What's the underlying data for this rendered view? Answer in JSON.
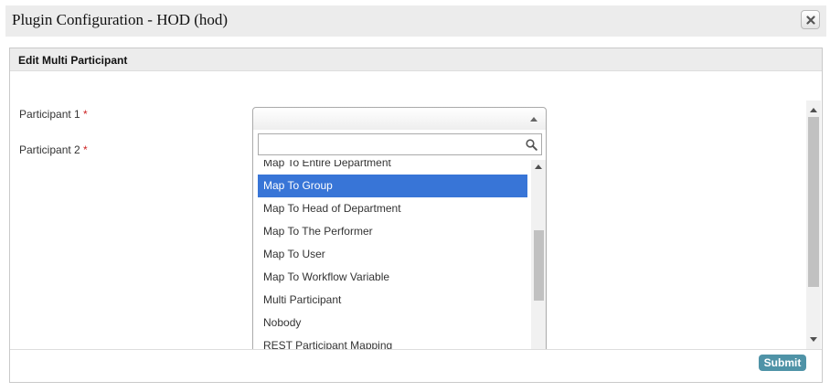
{
  "dialog": {
    "title": "Plugin Configuration - HOD (hod)",
    "close_icon": "close-icon"
  },
  "panel": {
    "title": "Edit Multi Participant"
  },
  "fields": [
    {
      "label": "Participant 1",
      "required_mark": "*"
    },
    {
      "label": "Participant 2",
      "required_mark": "*"
    }
  ],
  "dropdown": {
    "selected_value": "",
    "search_value": "",
    "search_icon": "search-icon",
    "items": [
      {
        "label": "Map To Entire Department",
        "highlighted": false
      },
      {
        "label": "Map To Group",
        "highlighted": true
      },
      {
        "label": "Map To Head of Department",
        "highlighted": false
      },
      {
        "label": "Map To The Performer",
        "highlighted": false
      },
      {
        "label": "Map To User",
        "highlighted": false
      },
      {
        "label": "Map To Workflow Variable",
        "highlighted": false
      },
      {
        "label": "Multi Participant",
        "highlighted": false
      },
      {
        "label": "Nobody",
        "highlighted": false
      },
      {
        "label": "REST Participant Mapping",
        "highlighted": false
      }
    ]
  },
  "footer": {
    "submit_label": "Submit"
  },
  "colors": {
    "highlight": "#3875d7",
    "submit": "#4f93a7",
    "required": "#cc2222"
  }
}
